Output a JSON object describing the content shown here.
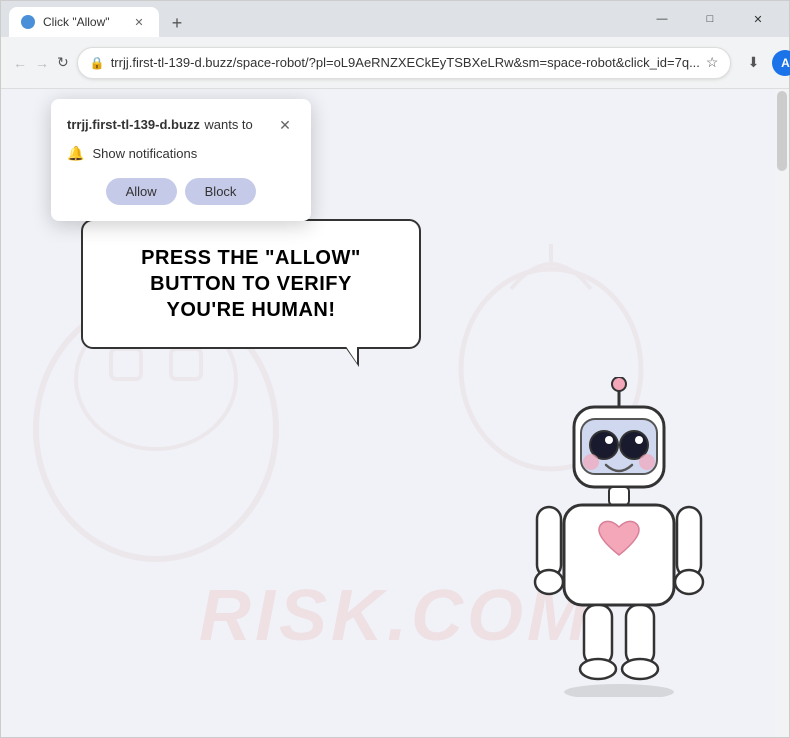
{
  "browser": {
    "tab": {
      "title": "Click \"Allow\"",
      "favicon": "globe"
    },
    "new_tab_label": "+",
    "window_controls": {
      "minimize": "—",
      "maximize": "□",
      "close": "✕"
    },
    "address_bar": {
      "url": "trrjj.first-tl-139-d.buzz/space-robot/?pl=oL9AeRNZXECkEyTSBXeLRw&sm=space-robot&click_id=7q...",
      "lock_icon": "🔒"
    },
    "toolbar": {
      "download_icon": "⬇",
      "profile_letter": "A",
      "menu_icon": "⋮"
    },
    "nav": {
      "back": "←",
      "forward": "→",
      "reload": "↻"
    }
  },
  "notification_popup": {
    "domain": "trrjj.first-tl-139-d.buzz",
    "wants_text": " wants to",
    "show_notifications_label": "Show notifications",
    "allow_label": "Allow",
    "block_label": "Block",
    "close_icon": "✕"
  },
  "page": {
    "speech_text": "PRESS THE \"ALLOW\" BUTTON TO VERIFY YOU'RE HUMAN!",
    "watermark": "RISK.COM"
  }
}
